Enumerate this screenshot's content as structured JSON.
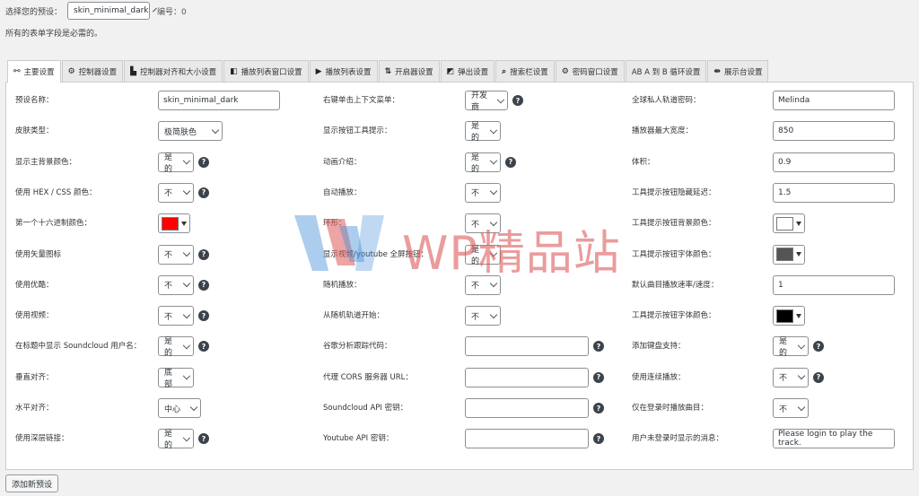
{
  "top": {
    "preset_label": "选择您的预设：",
    "preset_value": "skin_minimal_dark",
    "id_text": "编号：0",
    "note": "所有的表单字段是必需的。"
  },
  "tabs": [
    {
      "icon": "sliders-icon",
      "glyph": "⚯",
      "label": "主要设置"
    },
    {
      "icon": "gear-icon",
      "glyph": "⚙",
      "label": "控制器设置"
    },
    {
      "icon": "align-icon",
      "glyph": "▙",
      "label": "控制器对齐和大小设置"
    },
    {
      "icon": "playlist-window-icon",
      "glyph": "◧",
      "label": "播放列表窗口设置"
    },
    {
      "icon": "playlist-icon",
      "glyph": "▶",
      "label": "播放列表设置"
    },
    {
      "icon": "sort-icon",
      "glyph": "⇅",
      "label": "开启器设置"
    },
    {
      "icon": "popup-icon",
      "glyph": "◩",
      "label": "弹出设置"
    },
    {
      "icon": "search-bar-icon",
      "glyph": "⌕",
      "label": "搜索栏设置"
    },
    {
      "icon": "password-gear-icon",
      "glyph": "⚙",
      "label": "密码窗口设置"
    },
    {
      "icon": "ab-loop-icon",
      "glyph": "",
      "label": "AB A 到 B 循环设置"
    },
    {
      "icon": "console-icon",
      "glyph": "⇼",
      "label": "展示台设置"
    }
  ],
  "fields": {
    "col1": [
      {
        "label": "预设名称：",
        "type": "text",
        "value": "skin_minimal_dark"
      },
      {
        "label": "皮肤类型：",
        "type": "select",
        "value": "极简肤色"
      },
      {
        "label": "显示主背景颜色：",
        "type": "select-help",
        "value": "是的"
      },
      {
        "label": "使用 HEX / CSS 颜色：",
        "type": "select-help",
        "value": "不"
      },
      {
        "label": "第一个十六进制颜色：",
        "type": "color",
        "value": "#ff0000"
      },
      {
        "label": "使用矢量图标",
        "type": "select-help",
        "value": "不"
      },
      {
        "label": "使用优酷：",
        "type": "select-help",
        "value": "不"
      },
      {
        "label": "使用视频：",
        "type": "select-help",
        "value": "不"
      },
      {
        "label": "在标题中显示 Soundcloud 用户名：",
        "type": "select-help",
        "value": "是的"
      },
      {
        "label": "垂直对齐：",
        "type": "select",
        "value": "底部"
      },
      {
        "label": "水平对齐：",
        "type": "select",
        "value": "中心"
      },
      {
        "label": "使用深层链接：",
        "type": "select-help",
        "value": "是的"
      }
    ],
    "col2": [
      {
        "label": "右键单击上下文菜单：",
        "type": "select-help",
        "value": "开发商"
      },
      {
        "label": "显示按钮工具提示：",
        "type": "select",
        "value": "是的"
      },
      {
        "label": "动画介绍：",
        "type": "select-help",
        "value": "是的"
      },
      {
        "label": "自动播放：",
        "type": "select",
        "value": "不"
      },
      {
        "label": "环形：",
        "type": "select",
        "value": "不"
      },
      {
        "label": "显示视频/youtube 全屏按钮：",
        "type": "select",
        "value": "是的"
      },
      {
        "label": "随机播放：",
        "type": "select",
        "value": "不"
      },
      {
        "label": "从随机轨道开始：",
        "type": "select",
        "value": "不"
      },
      {
        "label": "谷歌分析跟踪代码：",
        "type": "text-help",
        "value": ""
      },
      {
        "label": "代理 CORS 服务器 URL：",
        "type": "text-help",
        "value": ""
      },
      {
        "label": "Soundcloud API 密钥：",
        "type": "text-help",
        "value": ""
      },
      {
        "label": "Youtube API 密钥：",
        "type": "text-help",
        "value": ""
      }
    ],
    "col3": [
      {
        "label": "全球私人轨道密码：",
        "type": "text",
        "value": "Melinda"
      },
      {
        "label": "播放器最大宽度：",
        "type": "text",
        "value": "850"
      },
      {
        "label": "体积：",
        "type": "text",
        "value": "0.9"
      },
      {
        "label": "工具提示按钮隐藏延迟：",
        "type": "text",
        "value": "1.5"
      },
      {
        "label": "工具提示按钮背景颜色：",
        "type": "color",
        "value": "#ffffff"
      },
      {
        "label": "工具提示按钮字体颜色：",
        "type": "color",
        "value": "#555555"
      },
      {
        "label": "默认曲目播放速率/速度：",
        "type": "text",
        "value": "1"
      },
      {
        "label": "工具提示按钮字体颜色：",
        "type": "color",
        "value": "#000000"
      },
      {
        "label": "添加键盘支持：",
        "type": "select-help",
        "value": "是的"
      },
      {
        "label": "使用连续播放：",
        "type": "select-help",
        "value": "不"
      },
      {
        "label": "仅在登录时播放曲目：",
        "type": "select",
        "value": "不"
      },
      {
        "label": "用户未登录时显示的消息：",
        "type": "text",
        "value": "Please login to play the track."
      }
    ]
  },
  "help_glyph": "?",
  "add_button": "添加新预设",
  "watermark": "WP精品站",
  "colors": {
    "watermark_blue": "#4a90d9",
    "watermark_red": "#dc5a5a"
  }
}
